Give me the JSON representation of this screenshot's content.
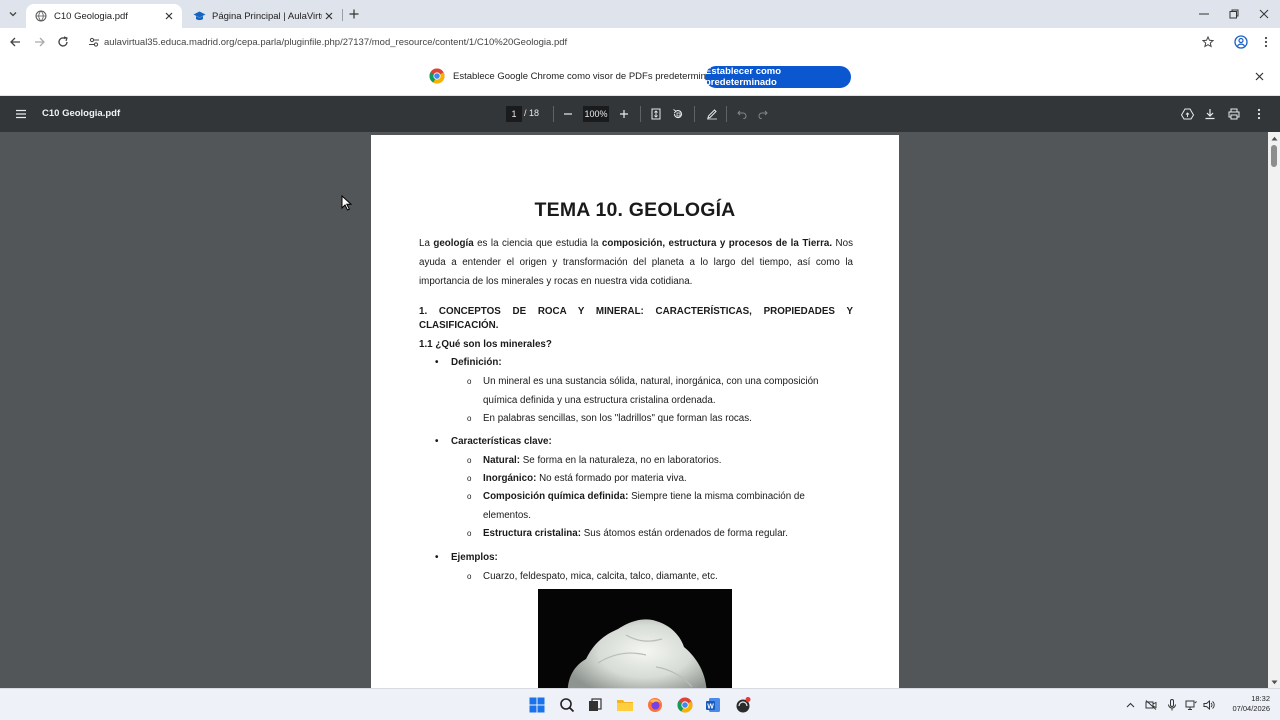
{
  "browser": {
    "tabs": [
      {
        "title": "C10 Geologia.pdf",
        "active": true
      },
      {
        "title": "Página Principal | AulaVirtual",
        "active": false
      }
    ],
    "url": "aulavirtual35.educa.madrid.org/cepa.parla/pluginfile.php/27137/mod_resource/content/1/C10%20Geologia.pdf"
  },
  "infobar": {
    "message": "Establece Google Chrome como visor de PDFs predeterminado",
    "button_label": "Establecer como predeterminado"
  },
  "pdf_toolbar": {
    "file_name": "C10 Geologia.pdf",
    "current_page": "1",
    "total_pages": "/ 18",
    "zoom": "100%"
  },
  "document": {
    "title": "TEMA 10. GEOLOGÍA",
    "intro": {
      "p1": "La ",
      "b1": "geología",
      "p2": " es la ciencia que estudia la ",
      "b2": "composición, estructura y procesos de la Tierra.",
      "p3": " Nos ayuda a entender el origen y transformación del planeta a lo largo del tiempo, así como la importancia de los minerales y rocas en nuestra vida cotidiana."
    },
    "section1": "1. CONCEPTOS DE ROCA Y MINERAL: CARACTERÍSTICAS, PROPIEDADES Y CLASIFICACIÓN.",
    "subsection": "1.1 ¿Qué son los minerales?",
    "definicion": {
      "label": "Definición:",
      "items": [
        "Un mineral es una sustancia sólida, natural, inorgánica, con una composición química definida y una estructura cristalina ordenada.",
        "En palabras sencillas, son los \"ladrillos\" que forman las rocas."
      ]
    },
    "caracteristicas": {
      "label": "Características clave:",
      "items": [
        {
          "term": "Natural:",
          "text": " Se forma en la naturaleza, no en laboratorios."
        },
        {
          "term": "Inorgánico:",
          "text": " No está formado por materia viva."
        },
        {
          "term": "Composición química definida:",
          "text": " Siempre tiene la misma combinación de elementos."
        },
        {
          "term": "Estructura cristalina:",
          "text": " Sus átomos están ordenados de forma regular."
        }
      ]
    },
    "ejemplos": {
      "label": "Ejemplos:",
      "items": [
        "Cuarzo, feldespato, mica, calcita, talco, diamante, etc."
      ]
    }
  },
  "taskbar": {
    "time": "18:32",
    "date": "07/04/2026"
  },
  "colors": {
    "accent": "#0b57d0",
    "pdf_toolbar": "#323639",
    "viewer_bg": "#525659"
  }
}
